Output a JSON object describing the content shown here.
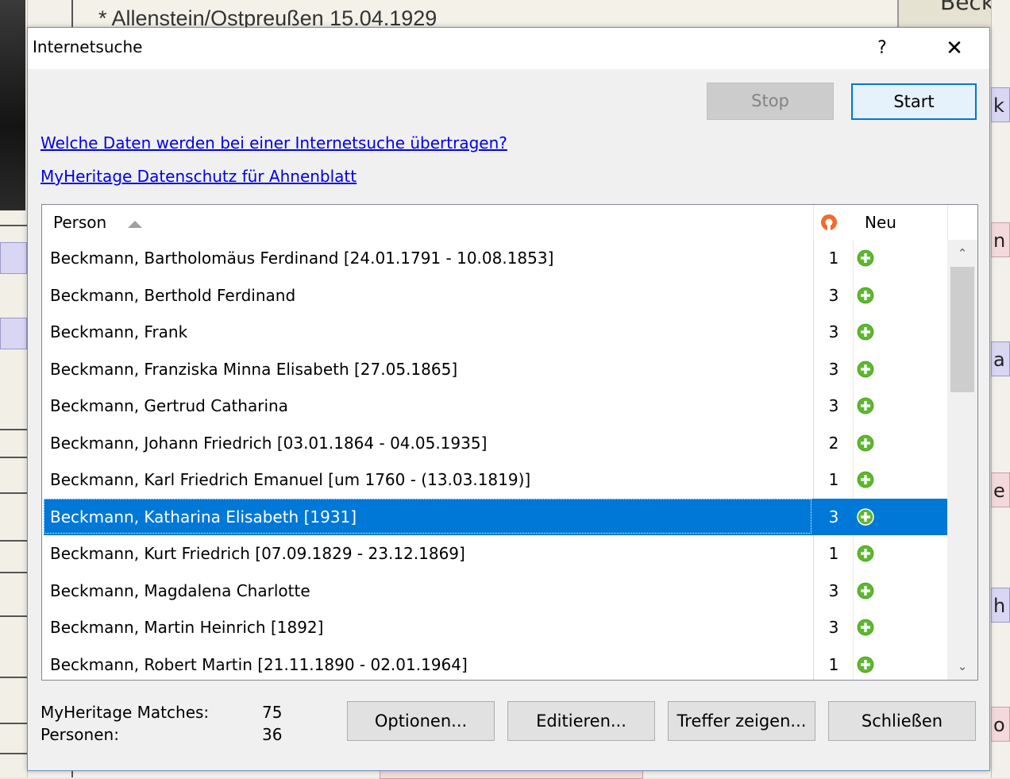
{
  "background": {
    "top_text": "* Allenstein/Ostpreußen 15.04.1929",
    "right_top_text": "Beck",
    "right_tabs": [
      "k",
      "n",
      "a",
      "e",
      "h",
      "o"
    ]
  },
  "dialog": {
    "title": "Internetsuche",
    "help_label": "?",
    "close_label": "✕",
    "stop_label": "Stop",
    "start_label": "Start",
    "link1": "Welche Daten werden bei einer Internetsuche übertragen?",
    "link2": "MyHeritage Datenschutz für Ahnenblatt",
    "list": {
      "col_person": "Person",
      "col_neu": "Neu",
      "rows": [
        {
          "name": "Beckmann, Bartholomäus Ferdinand [24.01.1791 - 10.08.1853]",
          "count": "1"
        },
        {
          "name": "Beckmann, Berthold Ferdinand",
          "count": "3"
        },
        {
          "name": "Beckmann, Frank",
          "count": "3"
        },
        {
          "name": "Beckmann, Franziska Minna Elisabeth [27.05.1865]",
          "count": "3"
        },
        {
          "name": "Beckmann, Gertrud Catharina",
          "count": "3"
        },
        {
          "name": "Beckmann, Johann Friedrich [03.01.1864 - 04.05.1935]",
          "count": "2"
        },
        {
          "name": "Beckmann, Karl Friedrich Emanuel [um 1760 - (13.03.1819)]",
          "count": "1"
        },
        {
          "name": "Beckmann, Katharina Elisabeth [1931]",
          "count": "3",
          "selected": true
        },
        {
          "name": "Beckmann, Kurt Friedrich [07.09.1829 - 23.12.1869]",
          "count": "1"
        },
        {
          "name": "Beckmann, Magdalena Charlotte",
          "count": "3"
        },
        {
          "name": "Beckmann, Martin Heinrich [1892]",
          "count": "3"
        },
        {
          "name": "Beckmann, Robert Martin [21.11.1890 - 02.01.1964]",
          "count": "1"
        }
      ]
    },
    "footer": {
      "matches_label": "MyHeritage Matches:",
      "matches_value": "75",
      "persons_label": "Personen:",
      "persons_value": "36",
      "optionen_label": "Optionen...",
      "editieren_label": "Editieren...",
      "treffer_label": "Treffer zeigen...",
      "schliessen_label": "Schließen"
    }
  },
  "colors": {
    "selection": "#0078d7",
    "plus_icon": "#5cb82e",
    "myheritage_icon": "#f26b2a",
    "link": "#0000ee"
  }
}
